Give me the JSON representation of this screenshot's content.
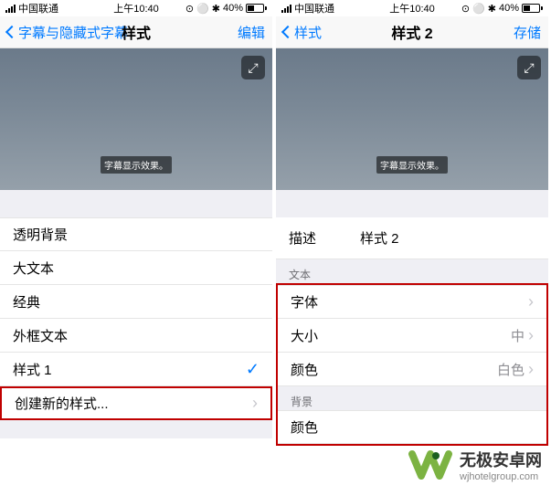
{
  "status": {
    "carrier": "中国联通",
    "time": "上午10:40",
    "battery_pct": "40%"
  },
  "left": {
    "nav_back": "字幕与隐藏式字幕",
    "nav_title": "样式",
    "nav_action": "编辑",
    "caption_sample": "字幕显示效果。",
    "rows": {
      "r0": "透明背景",
      "r1": "大文本",
      "r2": "经典",
      "r3": "外框文本",
      "r4": "样式 1",
      "r5": "创建新的样式..."
    }
  },
  "right": {
    "nav_back": "样式",
    "nav_title": "样式 2",
    "nav_action": "存储",
    "caption_sample": "字幕显示效果。",
    "desc_label": "描述",
    "desc_value": "样式 2",
    "section_text": "文本",
    "section_bg": "背景",
    "rows": {
      "font": "字体",
      "size": "大小",
      "size_val": "中",
      "color": "颜色",
      "color_val": "白色",
      "bg_color": "颜色"
    }
  },
  "watermark": {
    "title": "无极安卓网",
    "url": "wjhotelgroup.com"
  }
}
